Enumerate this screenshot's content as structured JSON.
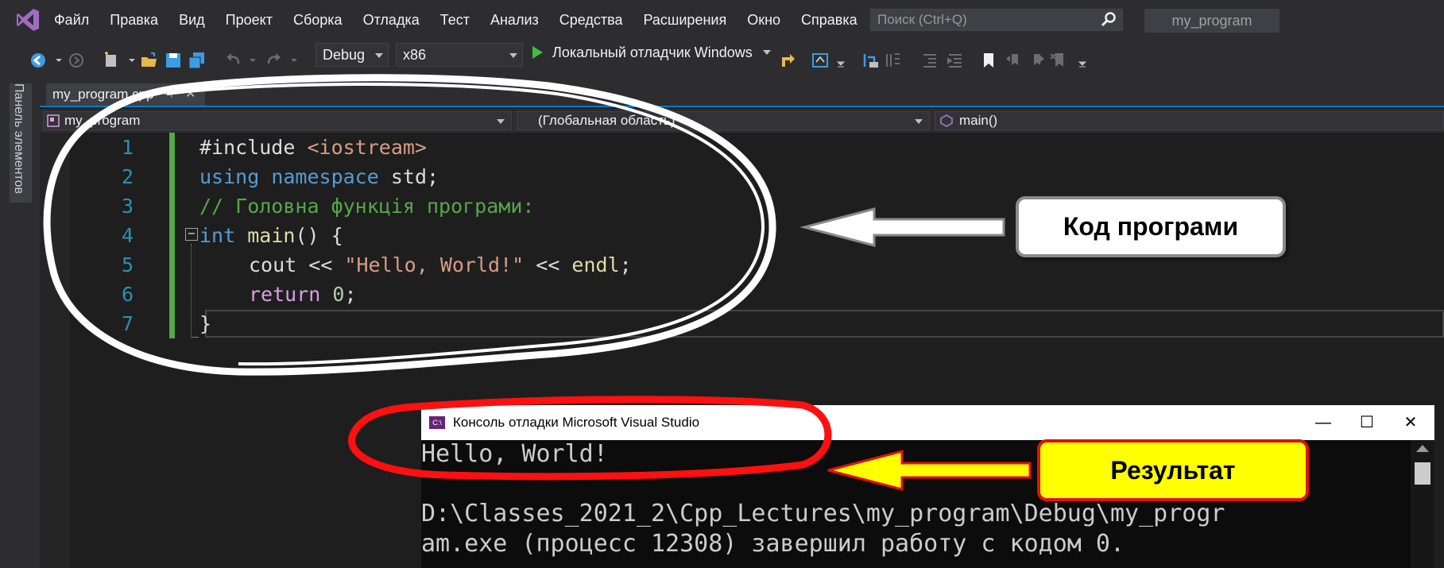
{
  "menubar": {
    "items": [
      "Файл",
      "Правка",
      "Вид",
      "Проект",
      "Сборка",
      "Отладка",
      "Тест",
      "Анализ",
      "Средства",
      "Расширения",
      "Окно",
      "Справка"
    ],
    "search_placeholder": "Поиск (Ctrl+Q)",
    "solution_name": "my_program"
  },
  "toolbar": {
    "config": "Debug",
    "platform": "x86",
    "run_label": "Локальный отладчик Windows"
  },
  "side_panel": {
    "label": "Панель элементов"
  },
  "editor_tab": {
    "filename": "my_program.cpp",
    "pin": "⊣",
    "close": "✕"
  },
  "navbar": {
    "project": "my_program",
    "scope": "(Глобальная область)",
    "member": "main()"
  },
  "code": {
    "line_numbers": [
      "1",
      "2",
      "3",
      "4",
      "5",
      "6",
      "7"
    ],
    "l1": {
      "directive": "#include ",
      "header": "<iostream>"
    },
    "l2": {
      "kw1": "using",
      "kw2": "namespace",
      "rest": " std;"
    },
    "l3": {
      "comment": "// Головна функція програми:"
    },
    "l4": {
      "fold": "−",
      "kw": "int",
      "fn": "main",
      "rest": "() {"
    },
    "l5": {
      "pre": "cout << ",
      "str": "\"Hello, World!\"",
      "mid": " << ",
      "fn": "endl",
      "end": ";"
    },
    "l6": {
      "kw": "return",
      "num": "0",
      "end": ";"
    },
    "l7": {
      "text": "}"
    }
  },
  "console": {
    "title": "Консоль отладки Microsoft Visual Studio",
    "icon_text": "C:\\",
    "controls": {
      "minimize": "—",
      "maximize": "☐",
      "close": "✕"
    },
    "lines": [
      "Hello, World!",
      "",
      "D:\\Classes_2021_2\\Cpp_Lectures\\my_program\\Debug\\my_progr",
      "am.exe (процесс 12308) завершил работу с кодом 0."
    ]
  },
  "annotations": {
    "code_label": "Код програми",
    "result_label": "Результат"
  },
  "colors": {
    "accent": "#007acc",
    "highlight_yellow": "#ffff00",
    "highlight_red": "#e01010"
  }
}
